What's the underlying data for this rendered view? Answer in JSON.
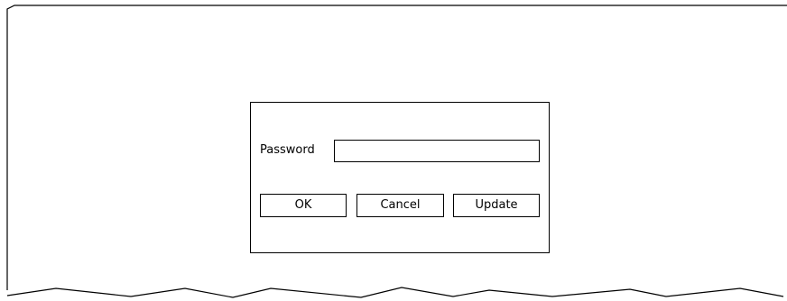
{
  "dialog": {
    "password_label": "Password",
    "password_value": "",
    "ok_label": "OK",
    "cancel_label": "Cancel",
    "update_label": "Update"
  }
}
